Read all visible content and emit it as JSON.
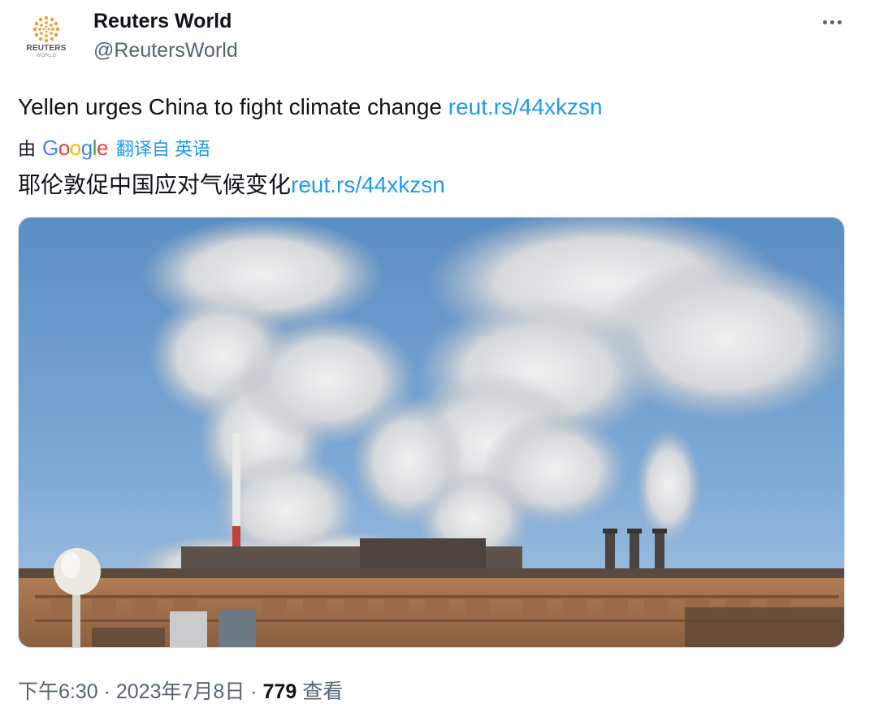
{
  "account": {
    "display_name": "Reuters World",
    "handle": "@ReutersWorld",
    "avatar_logo_text": "REUTERS",
    "avatar_logo_sub": "WORLD",
    "avatar_icon": "reuters-dot-logo"
  },
  "menu": {
    "more_icon": "more-horizontal-icon"
  },
  "tweet": {
    "text": "Yellen urges China to fight climate change ",
    "link": "reut.rs/44xkzsn"
  },
  "translation": {
    "by_label": "由",
    "provider_logo": {
      "letters": [
        "G",
        "o",
        "o",
        "g",
        "l",
        "e"
      ],
      "colors": [
        "#4285f4",
        "#ea4335",
        "#fbbc05",
        "#4285f4",
        "#34a853",
        "#ea4335"
      ]
    },
    "translated_from": "翻译自 英语",
    "text": "耶伦敦促中国应对气候变化",
    "link": "reut.rs/44xkzsn"
  },
  "media": {
    "type": "photo",
    "subject": "steel-plant-smokestacks-emitting-smoke"
  },
  "meta": {
    "time": "下午6:30",
    "separator": " · ",
    "date": "2023年7月8日",
    "views_count": "779",
    "views_label": "查看"
  },
  "colors": {
    "link": "#1d9bf0",
    "text": "#0f1419",
    "secondary": "#536471"
  }
}
